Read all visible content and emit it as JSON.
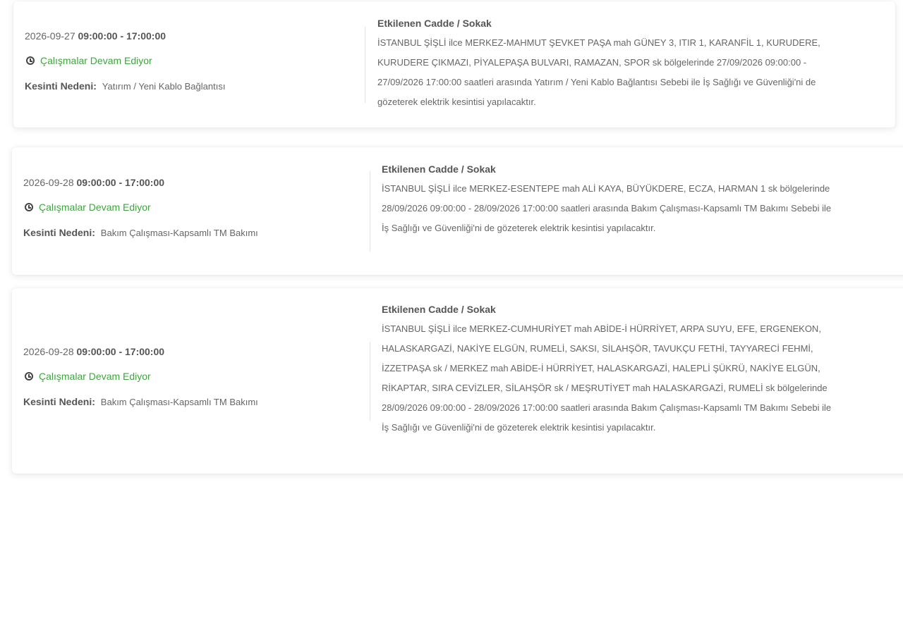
{
  "records": [
    {
      "date": "2026-09-27",
      "time_range": "09:00:00 - 17:00:00",
      "status": "Çalışmalar Devam Ediyor",
      "reason_label": "Kesinti Nedeni:",
      "reason": "Yatırım / Yeni Kablo Bağlantısı",
      "affected_title": "Etkilenen Cadde / Sokak",
      "affected_text": "İSTANBUL ŞİŞLİ ilce MERKEZ-MAHMUT ŞEVKET PAŞA mah GÜNEY 3, ITIR 1, KARANFİL 1, KURUDERE, KURUDERE ÇIKMAZI, PİYALEPAŞA BULVARI, RAMAZAN, SPOR sk bölgelerinde 27/09/2026 09:00:00 - 27/09/2026 17:00:00 saatleri arasında Yatırım / Yeni Kablo Bağlantısı Sebebi ile İş Sağlığı ve Güvenliği'ni de gözeterek elektrik kesintisi yapılacaktır."
    },
    {
      "date": "2026-09-28",
      "time_range": "09:00:00 - 17:00:00",
      "status": "Çalışmalar Devam Ediyor",
      "reason_label": "Kesinti Nedeni:",
      "reason": "Bakım Çalışması-Kapsamlı TM Bakımı",
      "affected_title": "Etkilenen Cadde / Sokak",
      "affected_text": "İSTANBUL ŞİŞLİ ilce MERKEZ-ESENTEPE mah ALİ KAYA, BÜYÜKDERE, ECZA, HARMAN 1 sk bölgelerinde 28/09/2026 09:00:00 - 28/09/2026 17:00:00 saatleri arasında Bakım Çalışması-Kapsamlı TM Bakımı Sebebi ile İş Sağlığı ve Güvenliği'ni de gözeterek elektrik kesintisi yapılacaktır."
    },
    {
      "date": "2026-09-28",
      "time_range": "09:00:00 - 17:00:00",
      "status": "Çalışmalar Devam Ediyor",
      "reason_label": "Kesinti Nedeni:",
      "reason": "Bakım Çalışması-Kapsamlı TM Bakımı",
      "affected_title": "Etkilenen Cadde / Sokak",
      "affected_text": "İSTANBUL ŞİŞLİ ilce MERKEZ-CUMHURİYET mah ABİDE-İ HÜRRİYET, ARPA SUYU, EFE, ERGENEKON, HALASKARGAZİ, NAKİYE ELGÜN, RUMELİ, SAKSI, SİLAHŞÖR, TAVUKÇU FETHİ, TAYYARECİ FEHMİ, İZZETPAŞA sk / MERKEZ mah ABİDE-İ HÜRRİYET, HALASKARGAZİ, HALEPLİ ŞÜKRÜ, NAKİYE ELGÜN, RİKAPTAR, SIRA CEVİZLER, SİLAHŞÖR sk / MEŞRUTİYET mah HALASKARGAZİ, RUMELİ sk bölgelerinde 28/09/2026 09:00:00 - 28/09/2026 17:00:00 saatleri arasında Bakım Çalışması-Kapsamlı TM Bakımı Sebebi ile İş Sağlığı ve Güvenliği'ni de gözeterek elektrik kesintisi yapılacaktır."
    }
  ]
}
